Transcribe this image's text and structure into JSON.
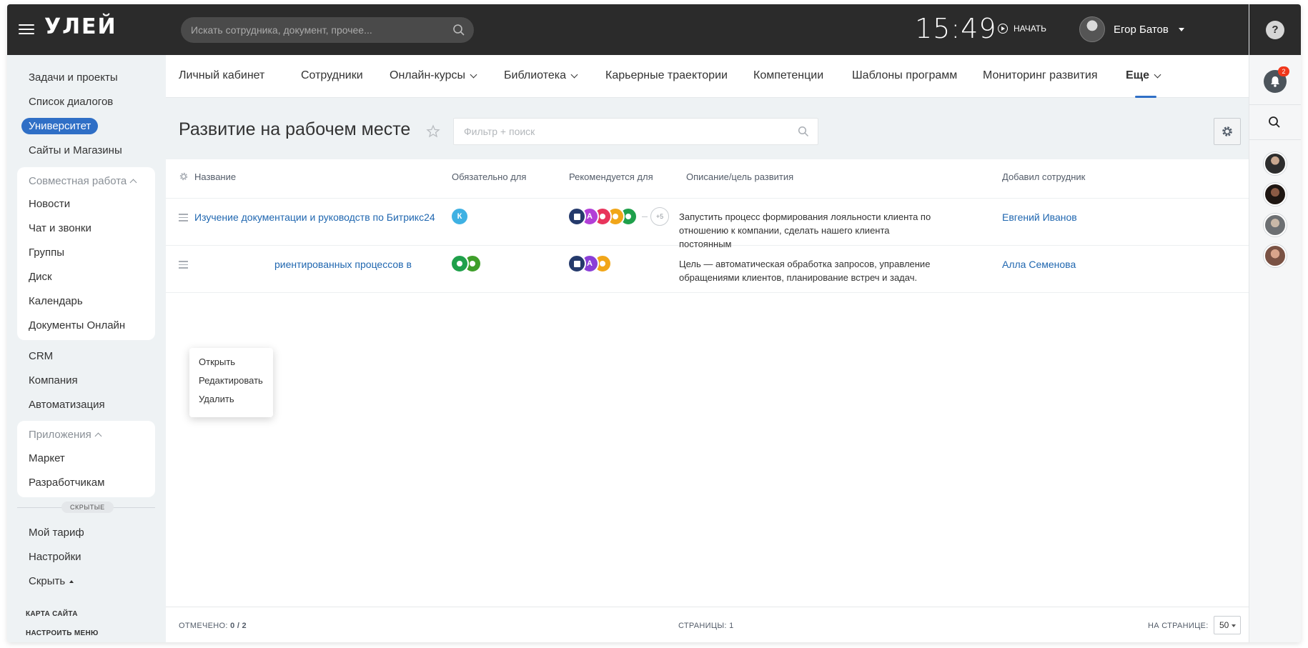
{
  "header": {
    "logo": "УЛЕЙ",
    "search_placeholder": "Искать сотрудника, документ, прочее...",
    "time": "15:49",
    "start_label": "НАЧАТЬ",
    "user_name": "Егор Батов"
  },
  "right_panel": {
    "notifications_count": "2",
    "help_symbol": "?"
  },
  "sidebar": {
    "top_items": [
      "Задачи и проекты",
      "Список диалогов",
      "Университет",
      "Сайты и Магазины"
    ],
    "active_item": "Университет",
    "group_collab": {
      "title": "Совместная работа",
      "items": [
        "Новости",
        "Чат и звонки",
        "Группы",
        "Диск",
        "Календарь",
        "Документы Онлайн"
      ]
    },
    "middle_items": [
      "CRM",
      "Компания",
      "Автоматизация"
    ],
    "group_apps": {
      "title": "Приложения",
      "items": [
        "Маркет",
        "Разработчикам"
      ]
    },
    "hidden_label": "СКРЫТЫЕ",
    "bottom_items": [
      "Мой тариф",
      "Настройки",
      "Скрыть"
    ],
    "footer_links": [
      "КАРТА САЙТА",
      "НАСТРОИТЬ МЕНЮ"
    ]
  },
  "tabs": [
    {
      "label": "Личный кабинет",
      "dropdown": false
    },
    {
      "label": "Сотрудники",
      "dropdown": false
    },
    {
      "label": "Онлайн-курсы",
      "dropdown": true
    },
    {
      "label": "Библиотека",
      "dropdown": true
    },
    {
      "label": "Карьерные траектории",
      "dropdown": false
    },
    {
      "label": "Компетенции",
      "dropdown": false
    },
    {
      "label": "Шаблоны программ",
      "dropdown": false
    },
    {
      "label": "Мониторинг развития",
      "dropdown": false
    },
    {
      "label": "Еще",
      "dropdown": true,
      "active": true
    }
  ],
  "page": {
    "title": "Развитие на рабочем месте",
    "filter_placeholder": "Фильтр + поиск"
  },
  "table": {
    "columns": [
      "Название",
      "Обязательно для",
      "Рекомендуется для",
      "Описание/цель развития",
      "Добавил сотрудник"
    ],
    "rows": [
      {
        "title": "Изучение документации и руководств по Битрикс24",
        "required": [
          {
            "label": "К",
            "color": "#3fb1e3"
          }
        ],
        "recommended": [
          {
            "label": "",
            "color": "#253a6c",
            "icon": "check"
          },
          {
            "label": "А",
            "color": "#b23fd7"
          },
          {
            "label": "",
            "color": "#e8355c",
            "icon": "award"
          },
          {
            "label": "",
            "color": "#f1a619",
            "icon": "gear"
          },
          {
            "label": "",
            "color": "#1fa04b",
            "icon": "pencil"
          }
        ],
        "recommended_more": "+5",
        "description": "Запустить процесс формирования лояльности клиента по отношению к компании, сделать нашего клиента постоянным",
        "author": "Евгений Иванов"
      },
      {
        "title": "риентированных процессов в",
        "required": [
          {
            "label": "",
            "color": "#1fa04b",
            "icon": "pencil"
          },
          {
            "label": "",
            "color": "#3f9f2a",
            "icon": "award"
          }
        ],
        "recommended": [
          {
            "label": "",
            "color": "#253a6c",
            "icon": "check"
          },
          {
            "label": "А",
            "color": "#8a3fd7"
          },
          {
            "label": "",
            "color": "#f1a619",
            "icon": "gear"
          }
        ],
        "recommended_more": "",
        "description": "Цель — автоматическая обработка запросов, управление обращениями клиентов, планирование встреч и задач.",
        "author": "Алла Семенова"
      }
    ]
  },
  "context_menu": [
    "Открыть",
    "Редактировать",
    "Удалить"
  ],
  "footer": {
    "selected_label": "ОТМЕЧЕНО:",
    "selected_value": "0 / 2",
    "pages_label": "СТРАНИЦЫ: 1",
    "per_page_label": "НА СТРАНИЦЕ:",
    "per_page_value": "50"
  },
  "colors": {
    "accent": "#2f6fc6",
    "link": "#2067b0",
    "topbar": "#2b2b2b"
  }
}
